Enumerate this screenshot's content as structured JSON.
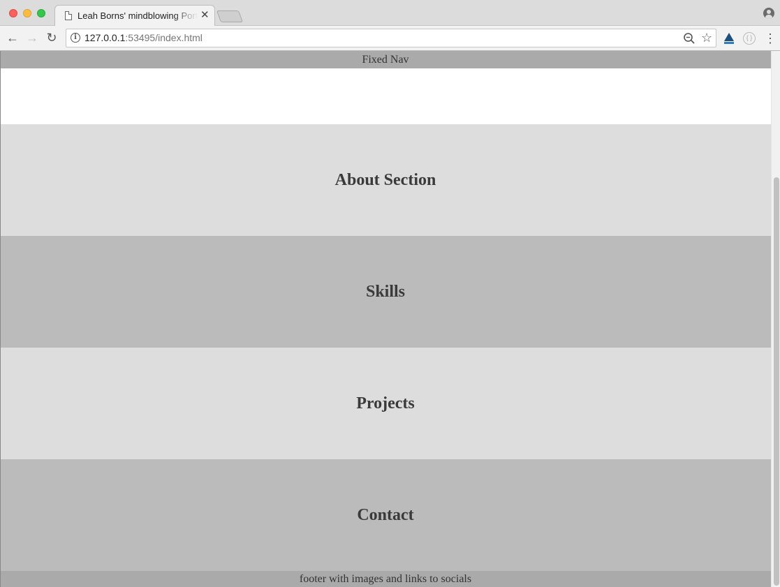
{
  "browser": {
    "tab_title": "Leah Borns' mindblowing Portfolio",
    "tab_close": "✕",
    "url_host": "127.0.0.1",
    "url_rest": ":53495/index.html"
  },
  "icons": {
    "back": "←",
    "forward": "→",
    "reload": "↻",
    "info": "i",
    "star": "☆",
    "menu": "⋮",
    "ext2": "{ }"
  },
  "page": {
    "nav_text": "Fixed Nav",
    "sections": [
      {
        "title": "About Section"
      },
      {
        "title": "Skills"
      },
      {
        "title": "Projects"
      },
      {
        "title": "Contact"
      }
    ],
    "footer_text": "footer with images and links to socials"
  }
}
